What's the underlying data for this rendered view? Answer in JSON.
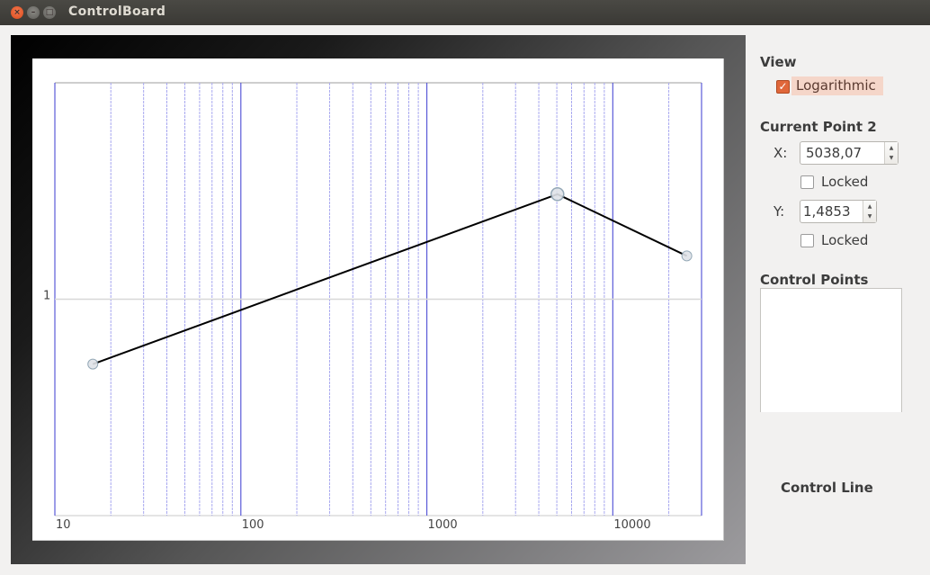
{
  "window": {
    "title": "ControlBoard",
    "buttons": {
      "close": "×",
      "minimize": "–",
      "maximize": "□"
    }
  },
  "sidebar": {
    "view_heading": "View",
    "logarithmic_label": "Logarithmic",
    "logarithmic_checked": true,
    "current_point_heading": "Current Point 2",
    "x_label": "X:",
    "x_value": "5038,07",
    "x_locked_label": "Locked",
    "x_locked_checked": false,
    "y_label": "Y:",
    "y_value": "1,4853",
    "y_locked_label": "Locked",
    "y_locked_checked": false,
    "control_points_heading": "Control Points",
    "control_points_items": [],
    "control_line_label": "Control Line"
  },
  "colors": {
    "accent": "#e0673a",
    "grid_major": "#5a5ad8",
    "grid_minor": "#a8a8f0",
    "line": "#000000",
    "point_fill": "#dfe3e8",
    "point_stroke": "#8aa0b0"
  },
  "chart_data": {
    "type": "line",
    "title": "",
    "xlabel": "",
    "ylabel": "",
    "xscale": "log",
    "xlim": [
      10,
      30000
    ],
    "ylim": [
      0,
      2
    ],
    "x_tick_labels": [
      "10",
      "100",
      "1000",
      "10000"
    ],
    "x_ticks": [
      10,
      100,
      1000,
      10000
    ],
    "y_tick_labels": [
      "1"
    ],
    "y_ticks": [
      1
    ],
    "grid": true,
    "legend": "none",
    "series": [
      {
        "name": "control-line",
        "x": [
          16,
          5038.07,
          25000
        ],
        "y": [
          0.7,
          1.4853,
          1.2
        ]
      }
    ],
    "selected_point_index": 1
  }
}
